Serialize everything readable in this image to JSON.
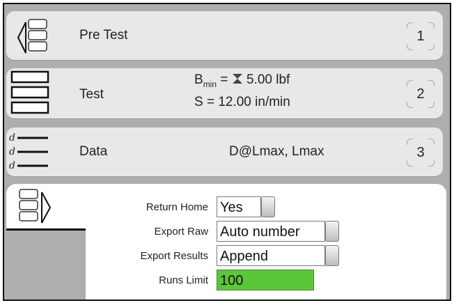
{
  "rows": [
    {
      "label": "Pre Test",
      "number": "1"
    },
    {
      "label": "Test",
      "number": "2",
      "line1_prefix": "B",
      "line1_sub": "min",
      "line1_suffix": " = ",
      "line1_value": "5.00 lbf",
      "line2": "S = 12.00 in/min"
    },
    {
      "label": "Data",
      "number": "3",
      "value": "D@Lmax, Lmax"
    }
  ],
  "export": {
    "fields": [
      {
        "label": "Return Home",
        "value": "Yes"
      },
      {
        "label": "Export Raw",
        "value": "Auto number"
      },
      {
        "label": "Export Results",
        "value": "Append"
      },
      {
        "label": "Runs Limit",
        "value": "100"
      }
    ]
  },
  "icons": {
    "pretest": "pretest-stack-icon",
    "test": "test-stack-icon",
    "data": "data-list-icon",
    "hourglass": "hourglass-icon",
    "export": "export-stack-icon"
  },
  "colors": {
    "active_field": "#5cc63a"
  }
}
